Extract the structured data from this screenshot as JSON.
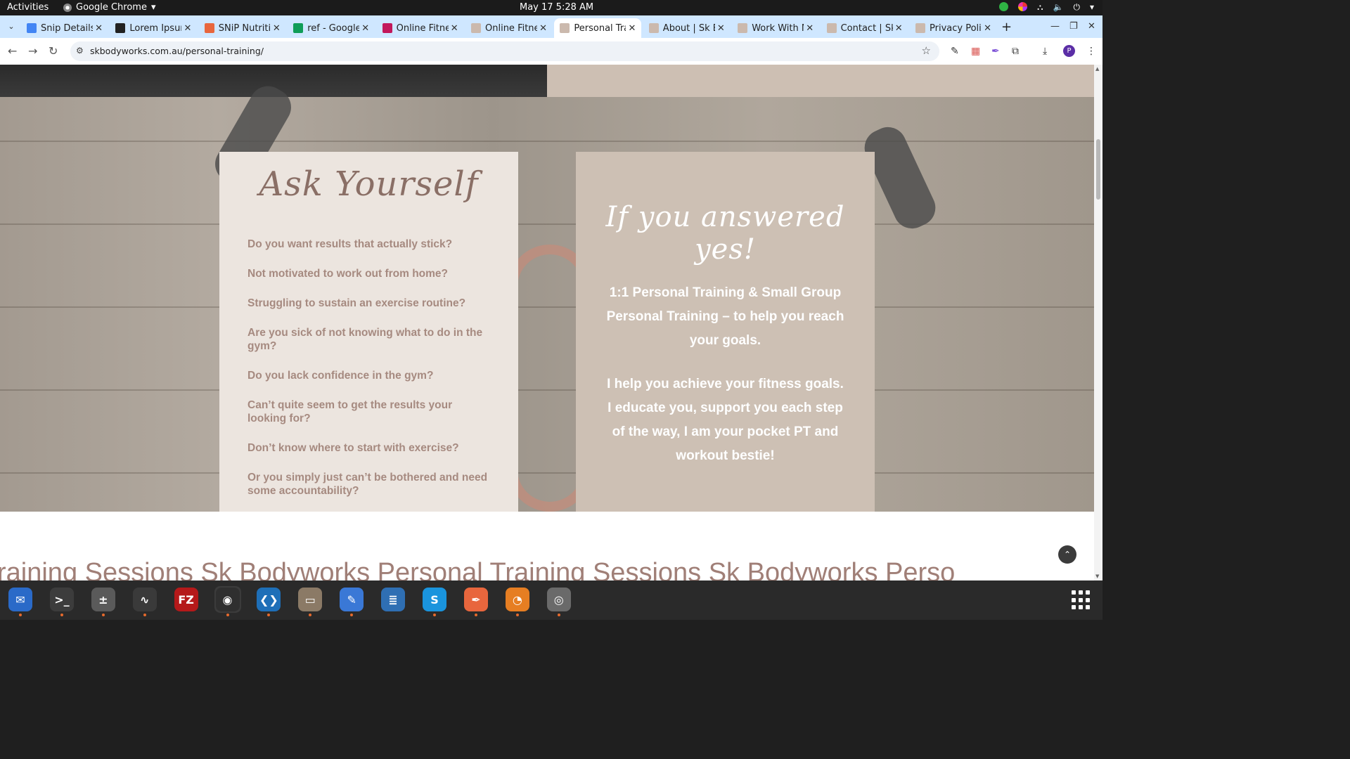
{
  "system": {
    "activities": "Activities",
    "app_name": "Google Chrome",
    "app_menu_arrow": "▾",
    "clock": "May 17  5:28 AM"
  },
  "browser": {
    "tabs": [
      {
        "label": "Snip Details",
        "favicon": "doc-icon",
        "color": "#4285f4"
      },
      {
        "label": "Lorem Ipsum",
        "favicon": "lorem-icon",
        "color": "#222222"
      },
      {
        "label": "SNiP Nutrition",
        "favicon": "snip-icon",
        "color": "#e8663d"
      },
      {
        "label": "ref - Google",
        "favicon": "sheets-icon",
        "color": "#0f9d58"
      },
      {
        "label": "Online Fitness",
        "favicon": "fitness-icon",
        "color": "#c2185b"
      },
      {
        "label": "Online Fitness",
        "favicon": "sk-icon",
        "color": "#cbb9ad"
      },
      {
        "label": "Personal Training",
        "favicon": "sk-icon",
        "color": "#cbb9ad",
        "active": true
      },
      {
        "label": "About | Sk Bodyworks",
        "favicon": "sk-icon",
        "color": "#cbb9ad"
      },
      {
        "label": "Work With Me",
        "favicon": "sk-icon",
        "color": "#cbb9ad"
      },
      {
        "label": "Contact | Sk",
        "favicon": "sk-icon",
        "color": "#cbb9ad"
      },
      {
        "label": "Privacy Policy",
        "favicon": "sk-icon",
        "color": "#cbb9ad"
      }
    ],
    "new_tab": "+",
    "url": "skbodyworks.com.au/personal-training/",
    "profile_initial": "P"
  },
  "page": {
    "left_card": {
      "heading": "Ask Yourself",
      "questions": [
        "Do you want results that actually stick?",
        "Not motivated to work out from home?",
        "Struggling to sustain an exercise routine?",
        "Are you sick of not knowing what to do in the gym?",
        "Do you lack confidence in the gym?",
        "Can’t quite seem to get the results your looking for?",
        "Don’t know where to start with exercise?",
        "Or you simply just can’t be bothered and need some accountability?"
      ]
    },
    "right_card": {
      "heading": "If you answered yes!",
      "paragraph_1": "1:1 Personal Training & Small Group Personal Training – to help you reach your goals.",
      "paragraph_2": "I help you achieve your fitness goals. I educate you, support you each step of the way, I am your pocket PT and workout bestie!"
    },
    "marquee_text": "raining Sessions  Sk Bodyworks Personal Training Sessions  Sk Bodyworks Perso",
    "back_to_top": "⌃"
  },
  "dock": [
    {
      "name": "thunderbird",
      "glyph": "✉",
      "color": "#2a6ac8",
      "running": true
    },
    {
      "name": "terminal",
      "glyph": ">_",
      "color": "#3c3c3c",
      "running": true
    },
    {
      "name": "calculator",
      "glyph": "±",
      "color": "#5a5a5a",
      "running": true
    },
    {
      "name": "system-monitor",
      "glyph": "∿",
      "color": "#3a3a3a",
      "running": true
    },
    {
      "name": "filezilla",
      "glyph": "FZ",
      "color": "#b5191a",
      "running": false
    },
    {
      "name": "chrome",
      "glyph": "◉",
      "color": "#2f2f2f",
      "running": true
    },
    {
      "name": "vscode",
      "glyph": "❮❯",
      "color": "#1e6fb8",
      "running": true
    },
    {
      "name": "files",
      "glyph": "▭",
      "color": "#8b7a66",
      "running": true
    },
    {
      "name": "text-editor",
      "glyph": "✎",
      "color": "#3a78d6",
      "running": true
    },
    {
      "name": "libreoffice-writer",
      "glyph": "≣",
      "color": "#2f6fb3",
      "running": false
    },
    {
      "name": "skype",
      "glyph": "S",
      "color": "#1a94dd",
      "running": true
    },
    {
      "name": "inkscape",
      "glyph": "✒",
      "color": "#e8663d",
      "running": true
    },
    {
      "name": "blender",
      "glyph": "◔",
      "color": "#e67e22",
      "running": true
    },
    {
      "name": "disk-utility",
      "glyph": "◎",
      "color": "#6a6a6a",
      "running": true
    }
  ]
}
